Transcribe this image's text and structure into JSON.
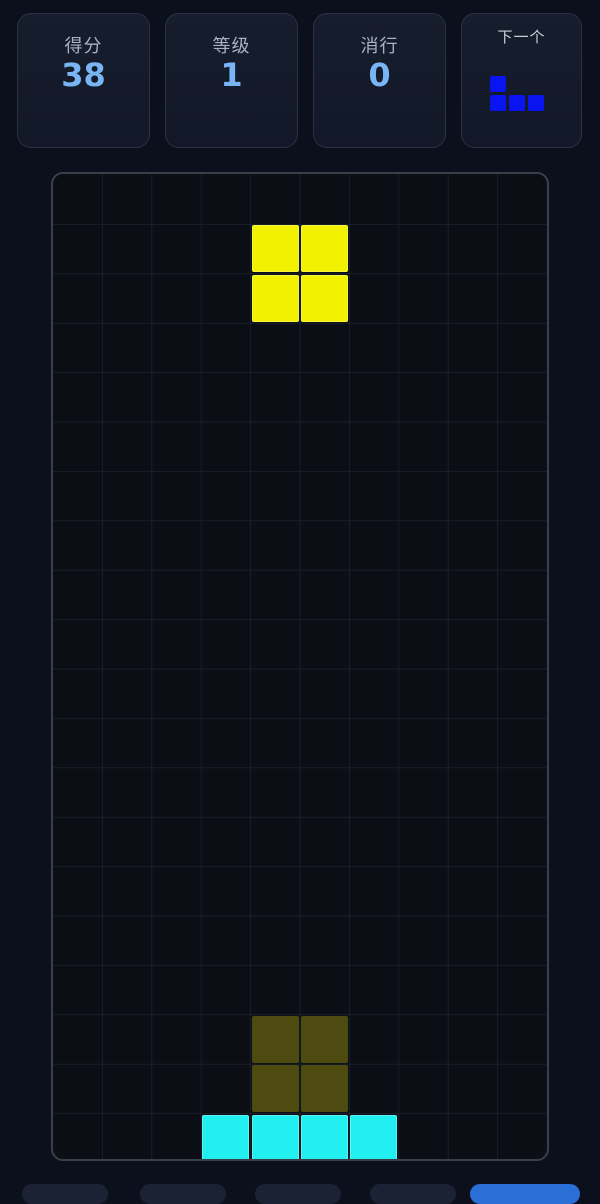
{
  "stats": {
    "score_label": "得分",
    "score_value": "38",
    "level_label": "等级",
    "level_value": "1",
    "lines_label": "消行",
    "lines_value": "0",
    "next_label": "下一个"
  },
  "next_piece": {
    "shape": "J",
    "color": "#0a14f0",
    "cells": [
      [
        0,
        0
      ],
      [
        0,
        1
      ],
      [
        1,
        1
      ],
      [
        2,
        1
      ]
    ]
  },
  "board": {
    "columns": 10,
    "rows": 20,
    "active_piece": {
      "shape": "O",
      "color": "#f2f200",
      "cells": [
        [
          4,
          1
        ],
        [
          5,
          1
        ],
        [
          4,
          2
        ],
        [
          5,
          2
        ]
      ]
    },
    "ghost_piece": {
      "shape": "O",
      "color": "#4d4b10",
      "cells": [
        [
          4,
          17
        ],
        [
          5,
          17
        ],
        [
          4,
          18
        ],
        [
          5,
          18
        ]
      ]
    },
    "locked_cells": [
      {
        "col": 3,
        "row": 19,
        "color": "#22f0f0"
      },
      {
        "col": 4,
        "row": 19,
        "color": "#22f0f0"
      },
      {
        "col": 5,
        "row": 19,
        "color": "#22f0f0"
      },
      {
        "col": 6,
        "row": 19,
        "color": "#22f0f0"
      }
    ]
  },
  "colors": {
    "accent_value": "#79b4f4",
    "grid_line": "#1a1f29",
    "board_border": "#3a404b"
  }
}
